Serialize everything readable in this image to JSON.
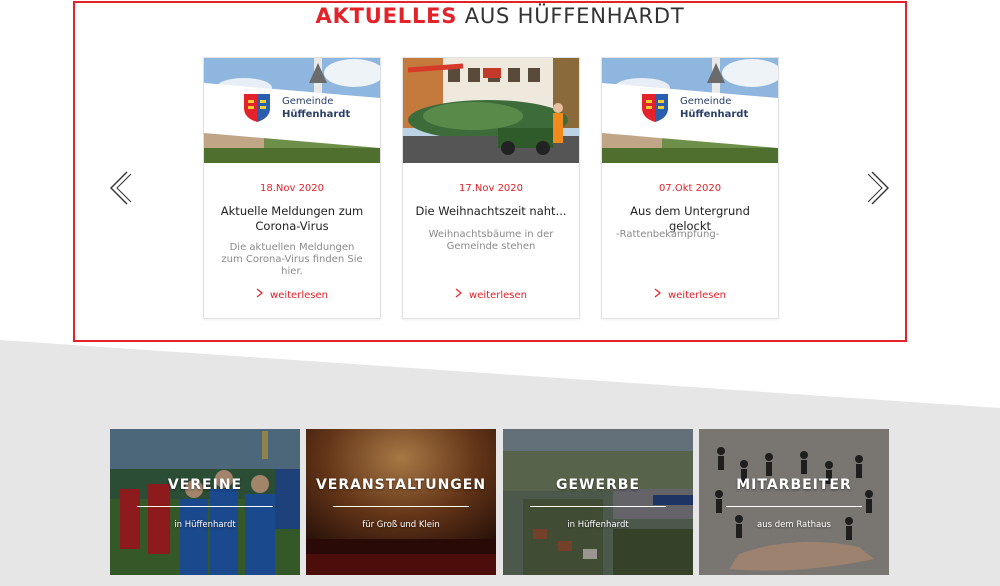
{
  "news": {
    "title_accent": "AKTUELLES",
    "title_rest": "AUS HÜFFENHARDT",
    "prev_icon": "chevron-left-icon",
    "next_icon": "chevron-right-icon",
    "items": [
      {
        "date": "18.Nov 2020",
        "title": "Aktuelle Meldungen zum Corona-Virus",
        "description": "Die aktuellen Meldungen zum Corona-Virus finden Sie hier.",
        "more": "weiterlesen",
        "image": "gemeinde-logo",
        "logo_line1": "Gemeinde",
        "logo_line2": "Hüffenhardt"
      },
      {
        "date": "17.Nov 2020",
        "title": "Die Weihnachtszeit naht...",
        "description": "Weihnachtsbäume in der Gemeinde stehen",
        "more": "weiterlesen",
        "image": "christmas-tree-delivery"
      },
      {
        "date": "07.Okt 2020",
        "title": "Aus dem Untergrund gelockt",
        "description": "-Rattenbekämpfung-",
        "more": "weiterlesen",
        "image": "gemeinde-logo",
        "logo_line1": "Gemeinde",
        "logo_line2": "Hüffenhardt"
      }
    ]
  },
  "tiles": [
    {
      "title": "VEREINE",
      "subtitle": "in Hüffenhardt",
      "image": "football-team"
    },
    {
      "title": "VERANSTALTUNGEN",
      "subtitle": "für Groß und Klein",
      "image": "concert-audience"
    },
    {
      "title": "GEWERBE",
      "subtitle": "in Hüffenhardt",
      "image": "aerial-town"
    },
    {
      "title": "MITARBEITER",
      "subtitle": "aus dem Rathaus",
      "image": "people-in-hand"
    }
  ],
  "colors": {
    "accent": "#e3222a",
    "grey_band": "#e6e6e6",
    "text": "#222222",
    "muted": "#8a8a8a"
  }
}
